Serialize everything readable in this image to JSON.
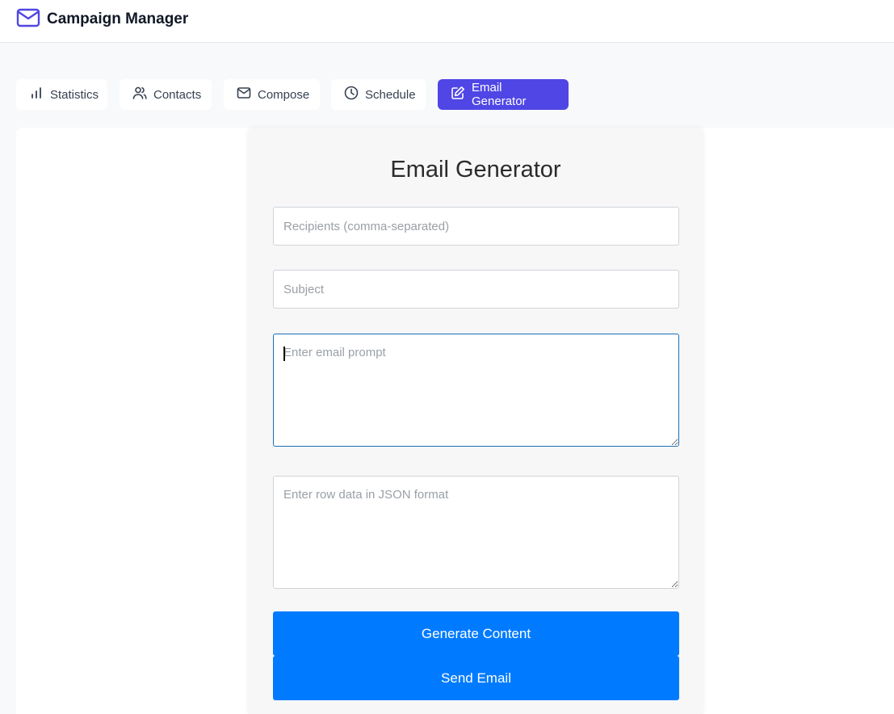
{
  "app": {
    "title": "Campaign Manager",
    "brand_icon": "mail-icon",
    "accent_color": "#4f46e5"
  },
  "tabs": [
    {
      "label": "Statistics",
      "icon": "bar-chart-icon",
      "active": false
    },
    {
      "label": "Contacts",
      "icon": "users-icon",
      "active": false
    },
    {
      "label": "Compose",
      "icon": "mail-icon",
      "active": false
    },
    {
      "label": "Schedule",
      "icon": "clock-icon",
      "active": false
    },
    {
      "label": "Email Generator",
      "icon": "edit-icon",
      "active": true
    }
  ],
  "generator": {
    "title": "Email Generator",
    "recipients": {
      "value": "",
      "placeholder": "Recipients (comma-separated)"
    },
    "subject": {
      "value": "",
      "placeholder": "Subject"
    },
    "prompt": {
      "value": "",
      "placeholder": "Enter email prompt"
    },
    "row_data": {
      "value": "",
      "placeholder": "Enter row data in JSON format"
    },
    "generate_label": "Generate Content",
    "send_label": "Send Email",
    "button_color": "#007bff"
  }
}
